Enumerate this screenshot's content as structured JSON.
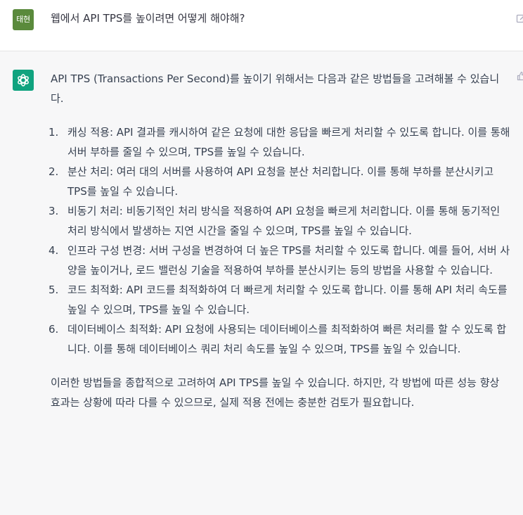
{
  "user": {
    "avatar_label": "태현",
    "message": "웹에서 API TPS를 높이려면 어떻게 해야해?"
  },
  "assistant": {
    "intro": "API TPS (Transactions Per Second)를 높이기 위해서는 다음과 같은 방법들을 고려해볼 수 있습니다.",
    "items": [
      {
        "num": "1.",
        "text": "캐싱 적용: API 결과를 캐시하여 같은 요청에 대한 응답을 빠르게 처리할 수 있도록 합니다. 이를 통해 서버 부하를 줄일 수 있으며, TPS를 높일 수 있습니다."
      },
      {
        "num": "2.",
        "text": "분산 처리: 여러 대의 서버를 사용하여 API 요청을 분산 처리합니다. 이를 통해 부하를 분산시키고 TPS를 높일 수 있습니다."
      },
      {
        "num": "3.",
        "text": "비동기 처리: 비동기적인 처리 방식을 적용하여 API 요청을 빠르게 처리합니다. 이를 통해 동기적인 처리 방식에서 발생하는 지연 시간을 줄일 수 있으며, TPS를 높일 수 있습니다."
      },
      {
        "num": "4.",
        "text": "인프라 구성 변경: 서버 구성을 변경하여 더 높은 TPS를 처리할 수 있도록 합니다. 예를 들어, 서버 사양을 높이거나, 로드 밸런싱 기술을 적용하여 부하를 분산시키는 등의 방법을 사용할 수 있습니다."
      },
      {
        "num": "5.",
        "text": "코드 최적화: API 코드를 최적화하여 더 빠르게 처리할 수 있도록 합니다. 이를 통해 API 처리 속도를 높일 수 있으며, TPS를 높일 수 있습니다."
      },
      {
        "num": "6.",
        "text": "데이터베이스 최적화: API 요청에 사용되는 데이터베이스를 최적화하여 빠른 처리를 할 수 있도록 합니다. 이를 통해 데이터베이스 쿼리 처리 속도를 높일 수 있으며, TPS를 높일 수 있습니다."
      }
    ],
    "conclusion": "이러한 방법들을 종합적으로 고려하여 API TPS를 높일 수 있습니다. 하지만, 각 방법에 따른 성능 향상 효과는 상황에 따라 다를 수 있으므로, 실제 적용 전에는 충분한 검토가 필요합니다."
  },
  "colors": {
    "user_avatar_bg": "#5a8a3c",
    "assistant_avatar_bg": "#10a37f",
    "assistant_row_bg": "#f7f7f8",
    "text": "#374151"
  },
  "icons": {
    "user_action": "edit-icon",
    "assistant_avatar": "openai-logo-icon",
    "assistant_action": "thumbs-up-icon"
  }
}
